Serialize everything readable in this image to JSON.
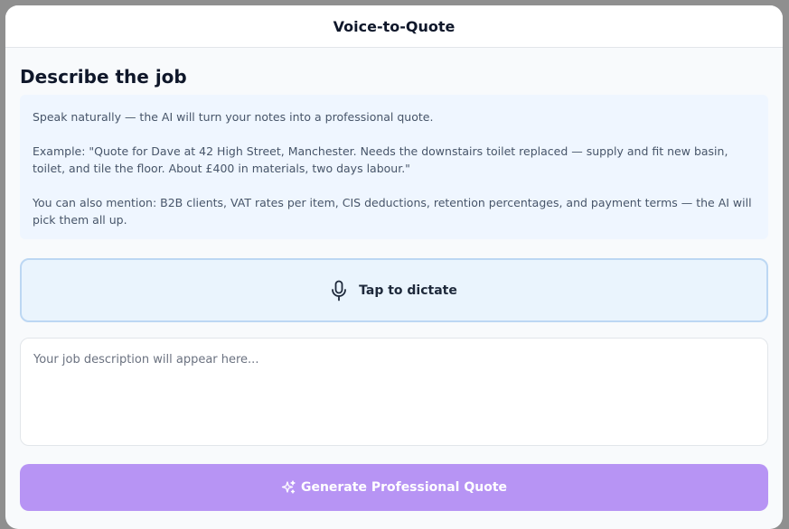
{
  "header": {
    "title": "Voice-to-Quote"
  },
  "main": {
    "section_title": "Describe the job",
    "info": {
      "line1": "Speak naturally — the AI will turn your notes into a professional quote.",
      "line2": "Example: \"Quote for Dave at 42 High Street, Manchester. Needs the downstairs toilet replaced — supply and fit new basin, toilet, and tile the floor. About £400 in materials, two days labour.\"",
      "line3": "You can also mention: B2B clients, VAT rates per item, CIS deductions, retention percentages, and payment terms — the AI will pick them all up."
    },
    "dictate": {
      "label": "Tap to dictate",
      "icon": "microphone-icon"
    },
    "textarea": {
      "value": "",
      "placeholder": "Your job description will appear here..."
    },
    "generate": {
      "label": "Generate Professional Quote",
      "icon": "sparkles-icon"
    }
  },
  "colors": {
    "accent": "#b794f4",
    "dictate_bg": "#eaf4fd",
    "dictate_border": "#bcd7f3",
    "info_bg": "#eff6ff"
  }
}
